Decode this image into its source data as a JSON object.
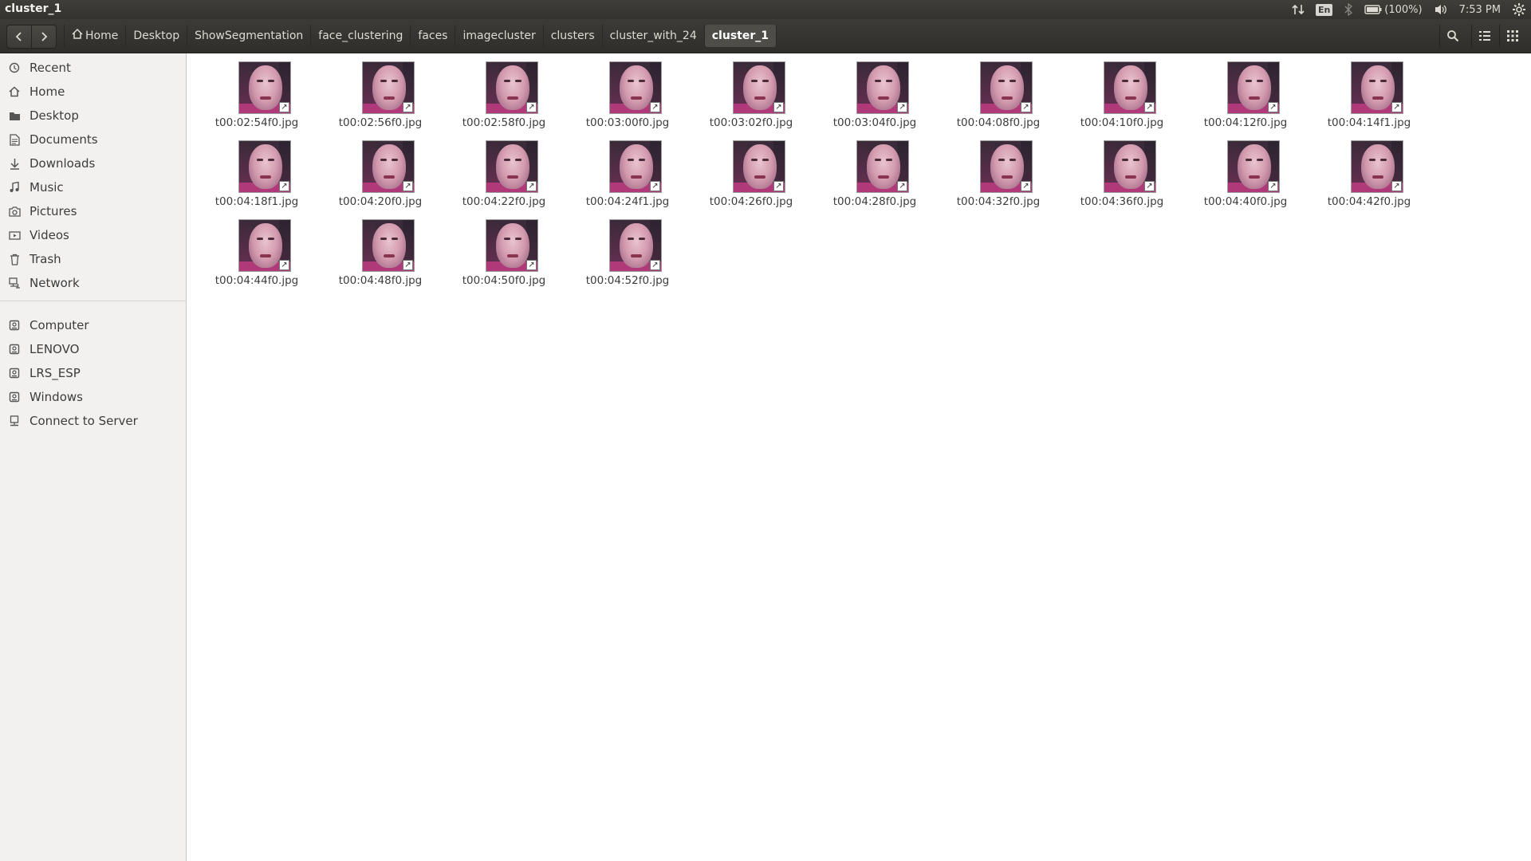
{
  "window_title": "cluster_1",
  "panel": {
    "language": "En",
    "battery": "(100%)",
    "time": "7:53 PM"
  },
  "breadcrumbs": [
    "Home",
    "Desktop",
    "ShowSegmentation",
    "face_clustering",
    "faces",
    "imagecluster",
    "clusters",
    "cluster_with_24",
    "cluster_1"
  ],
  "sidebar": {
    "places": [
      {
        "label": "Recent",
        "icon": "clock-icon"
      },
      {
        "label": "Home",
        "icon": "home-icon"
      },
      {
        "label": "Desktop",
        "icon": "folder-icon"
      },
      {
        "label": "Documents",
        "icon": "document-icon"
      },
      {
        "label": "Downloads",
        "icon": "download-icon"
      },
      {
        "label": "Music",
        "icon": "music-icon"
      },
      {
        "label": "Pictures",
        "icon": "camera-icon"
      },
      {
        "label": "Videos",
        "icon": "video-icon"
      },
      {
        "label": "Trash",
        "icon": "trash-icon"
      },
      {
        "label": "Network",
        "icon": "network-icon"
      }
    ],
    "devices": [
      {
        "label": "Computer",
        "icon": "drive-icon"
      },
      {
        "label": "LENOVO",
        "icon": "drive-icon"
      },
      {
        "label": "LRS_ESP",
        "icon": "drive-icon"
      },
      {
        "label": "Windows",
        "icon": "drive-icon"
      },
      {
        "label": "Connect to Server",
        "icon": "server-icon"
      }
    ]
  },
  "files": [
    "t00:02:54f0.jpg",
    "t00:02:56f0.jpg",
    "t00:02:58f0.jpg",
    "t00:03:00f0.jpg",
    "t00:03:02f0.jpg",
    "t00:03:04f0.jpg",
    "t00:04:08f0.jpg",
    "t00:04:10f0.jpg",
    "t00:04:12f0.jpg",
    "t00:04:14f1.jpg",
    "t00:04:18f1.jpg",
    "t00:04:20f0.jpg",
    "t00:04:22f0.jpg",
    "t00:04:24f1.jpg",
    "t00:04:26f0.jpg",
    "t00:04:28f0.jpg",
    "t00:04:32f0.jpg",
    "t00:04:36f0.jpg",
    "t00:04:40f0.jpg",
    "t00:04:42f0.jpg",
    "t00:04:44f0.jpg",
    "t00:04:48f0.jpg",
    "t00:04:50f0.jpg",
    "t00:04:52f0.jpg"
  ]
}
